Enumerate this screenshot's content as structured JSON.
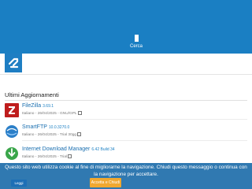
{
  "header": {
    "search_label": "Cerca",
    "icon": "search-icon",
    "bg_color": "#1a7fc3"
  },
  "logo": {
    "icon": "site-logo-icon",
    "color": "#1e7ec3"
  },
  "section": {
    "title": "Ultimi Aggiornamenti"
  },
  "updates": [
    {
      "name": "FileZilla",
      "version": "3.69.1",
      "meta": "Italiano - 26/04/2025 - GNU/GPL",
      "icon": "filezilla-icon"
    },
    {
      "name": "SmartFTP",
      "version": "10.0.3270.0",
      "meta": "Italiano - 26/04/2025 - Trial 30gg",
      "icon": "smartftp-icon"
    },
    {
      "name": "Internet Download Manager",
      "version": "6.42 Build 34",
      "meta": "Italiano - 26/04/2025 - Trial",
      "icon": "idm-icon"
    }
  ],
  "cookie": {
    "text": "Questo sito web utilizza cookie al fine di migliorarne la navigazione. Chiudi questo messaggio o continua con la navigazione per accettare.",
    "login_label": "Leggi",
    "accept_label": "Accetta e Chiudi",
    "accept_color": "#f0a830"
  }
}
